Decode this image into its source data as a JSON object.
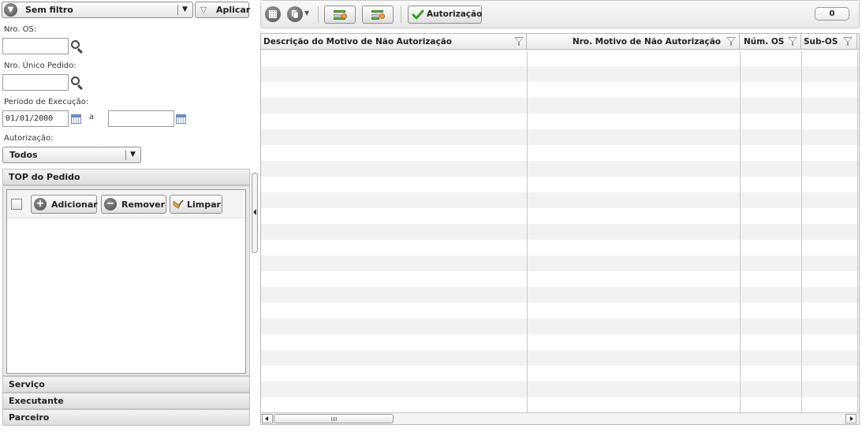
{
  "filter": {
    "selected": "Sem filtro",
    "apply_label": "Aplicar"
  },
  "fields": {
    "nro_os_label": "Nro. OS:",
    "nro_os_value": "",
    "nro_pedido_label": "Nro. Único Pedido:",
    "nro_pedido_value": "",
    "periodo_label": "Período de Execução:",
    "periodo_inicio": "01/01/2000",
    "periodo_sep": "a",
    "periodo_fim": "",
    "autorizacao_label": "Autorização:",
    "autorizacao_value": "Todos"
  },
  "top_pedido": {
    "title": "TOP do Pedido",
    "add_label": "Adicionar",
    "remove_label": "Remover",
    "clear_label": "Limpar"
  },
  "sections": {
    "servico": "Serviço",
    "executante": "Executante",
    "parceiro": "Parceiro"
  },
  "toolbar": {
    "autorizacao_label": "Autorização",
    "count": "0"
  },
  "grid": {
    "columns": [
      "Descrição do Motivo de Não Autorização",
      "Nro. Motivo de Não Autorização",
      "Núm. OS",
      "Sub-OS"
    ],
    "rows": []
  }
}
